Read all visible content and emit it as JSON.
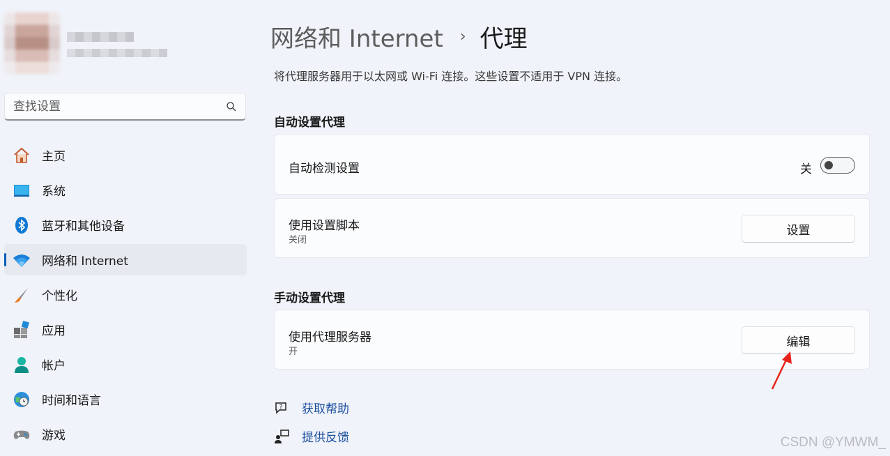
{
  "sidebar": {
    "search_placeholder": "查找设置",
    "items": [
      {
        "label": "主页",
        "icon": "home-icon"
      },
      {
        "label": "系统",
        "icon": "monitor-icon"
      },
      {
        "label": "蓝牙和其他设备",
        "icon": "bluetooth-icon"
      },
      {
        "label": "网络和 Internet",
        "icon": "wifi-icon",
        "active": true
      },
      {
        "label": "个性化",
        "icon": "brush-icon"
      },
      {
        "label": "应用",
        "icon": "apps-icon"
      },
      {
        "label": "帐户",
        "icon": "account-icon"
      },
      {
        "label": "时间和语言",
        "icon": "globe-clock-icon"
      },
      {
        "label": "游戏",
        "icon": "gamepad-icon"
      }
    ]
  },
  "header": {
    "breadcrumb_parent": "网络和 Internet",
    "breadcrumb_separator": "›",
    "breadcrumb_current": "代理"
  },
  "description": "将代理服务器用于以太网或 Wi-Fi 连接。这些设置不适用于 VPN 连接。",
  "auto_section": {
    "title": "自动设置代理",
    "detect": {
      "label": "自动检测设置",
      "state_text": "关",
      "on": false
    },
    "script": {
      "label": "使用设置脚本",
      "sub": "关闭",
      "button": "设置"
    }
  },
  "manual_section": {
    "title": "手动设置代理",
    "proxy": {
      "label": "使用代理服务器",
      "sub": "开",
      "button": "编辑"
    }
  },
  "footer_links": [
    {
      "label": "获取帮助",
      "icon": "help-chat-icon"
    },
    {
      "label": "提供反馈",
      "icon": "feedback-icon"
    }
  ],
  "watermark": "CSDN @YMWM_",
  "colors": {
    "accent": "#005fb8",
    "background": "#f0f3f9",
    "link": "#1a4fa0",
    "annotation_arrow": "#e8231b"
  }
}
